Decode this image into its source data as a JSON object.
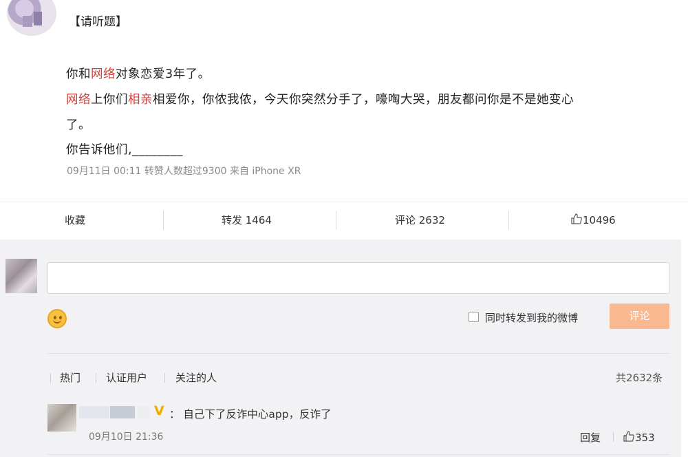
{
  "post": {
    "tag": "【请听题】",
    "line1": [
      "你和",
      "网络",
      "对象恋爱3年了。"
    ],
    "line2": [
      "网络",
      "上你们",
      "相亲",
      "相爱你，你侬我侬，今天你突然分手了，嚎啕大哭，朋友都问你是不是她变心"
    ],
    "line3": "了。",
    "line4": "你告诉他们,________",
    "meta": "09月11日 00:11 转赞人数超过9300  来自 iPhone XR"
  },
  "actions": {
    "favorite": "收藏",
    "repost": "转发 1464",
    "comment": "评论 2632",
    "like": "10496"
  },
  "composer": {
    "checkbox_label": "同时转发到我的微博",
    "submit": "评论"
  },
  "filters": {
    "hot": "热门",
    "verified": "认证用户",
    "following": "关注的人",
    "total": "共2632条"
  },
  "comment": {
    "text": "：  自己下了反诈中心app，反诈了",
    "time": "09月10日 21:36",
    "reply": "回复",
    "likes": "353"
  },
  "icons": {
    "smiley": "smiley-icon",
    "thumb": "thumbs-up-icon",
    "verified": "verified-v-icon"
  },
  "colors": {
    "highlight": "#d2403c",
    "submit_button": "#f9b88f",
    "verified_badge": "#f2a900"
  }
}
